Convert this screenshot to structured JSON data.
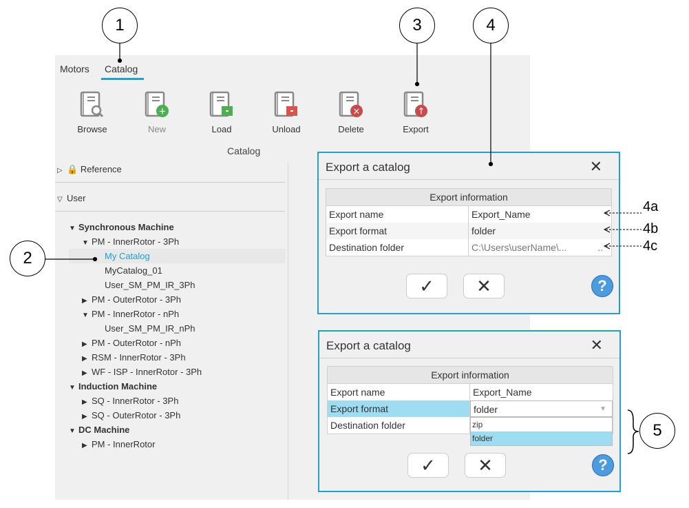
{
  "tabs": [
    "Motors",
    "Catalog"
  ],
  "toolbar": {
    "items": [
      {
        "label": "Browse",
        "icon": "browse-icon",
        "badge": "#999999"
      },
      {
        "label": "New",
        "icon": "new-icon",
        "badge": "#4caf50"
      },
      {
        "label": "Load",
        "icon": "load-icon",
        "badge": "#4caf50"
      },
      {
        "label": "Unload",
        "icon": "unload-icon",
        "badge": "#d9534f"
      },
      {
        "label": "Delete",
        "icon": "delete-icon",
        "badge": "#c94a4a"
      },
      {
        "label": "Export",
        "icon": "export-icon",
        "badge": "#c94a4a"
      }
    ],
    "group_label": "Catalog"
  },
  "tree": {
    "reference": "Reference",
    "user": "User",
    "rows": [
      "Synchronous Machine",
      "PM - InnerRotor - 3Ph",
      "My Catalog",
      "MyCatalog_01",
      "User_SM_PM_IR_3Ph",
      "PM - OuterRotor - 3Ph",
      "PM - InnerRotor - nPh",
      "User_SM_PM_IR_nPh",
      "PM - OuterRotor - nPh",
      "RSM - InnerRotor - 3Ph",
      "WF - ISP - InnerRotor - 3Ph",
      "Induction Machine",
      "SQ - InnerRotor - 3Ph",
      "SQ - OuterRotor - 3Ph",
      "DC Machine",
      "PM - InnerRotor"
    ]
  },
  "dialog": {
    "title": "Export a catalog",
    "header": "Export information",
    "rows": [
      {
        "label": "Export name",
        "value": "Export_Name"
      },
      {
        "label": "Export format",
        "value": "folder"
      },
      {
        "label": "Destination folder",
        "value": "C:\\Users\\userName\\..."
      }
    ],
    "browse": "..",
    "options": [
      "zip",
      "folder"
    ],
    "ok": "✓",
    "cancel": "✕",
    "help": "?",
    "close": "✕"
  },
  "callouts": [
    "1",
    "2",
    "3",
    "4",
    "5"
  ],
  "annotations": [
    "4a",
    "4b",
    "4c"
  ],
  "accent": "#1ba1d6"
}
